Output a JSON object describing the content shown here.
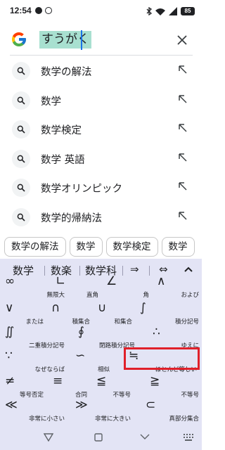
{
  "status_bar": {
    "time": "12:54",
    "battery": "85",
    "icons": [
      "chat-bubble-icon",
      "notification-icon",
      "bluetooth-icon",
      "wifi-icon",
      "signal-icon",
      "battery-icon"
    ]
  },
  "search": {
    "query": "すうがく",
    "logo": "google-g-logo",
    "clear_icon": "close-icon"
  },
  "suggestions": [
    {
      "text": "数学の解法"
    },
    {
      "text": "数学"
    },
    {
      "text": "数学検定"
    },
    {
      "text": "数学 英語"
    },
    {
      "text": "数学オリンピック"
    },
    {
      "text": "数学的帰納法"
    }
  ],
  "chips": [
    "数学の解法",
    "数学",
    "数学検定",
    "数学"
  ],
  "keyboard": {
    "candidates": [
      "数学",
      "数楽",
      "数学科"
    ],
    "candidate_arrows": [
      "⇒",
      "⇔"
    ],
    "collapse_icon": "chevron-up-icon",
    "symbols": [
      {
        "sym": "∞",
        "label": "無限大"
      },
      {
        "sym": "∟",
        "label": "直角"
      },
      {
        "sym": "∠",
        "label": "角"
      },
      {
        "sym": "∧",
        "label": "および"
      },
      {
        "sym": "∨",
        "label": "または"
      },
      {
        "sym": "∩",
        "label": "積集合"
      },
      {
        "sym": "∪",
        "label": "和集合"
      },
      {
        "sym": "∫",
        "label": "積分記号"
      },
      {
        "sym": "∬",
        "label": "二重積分記号"
      },
      {
        "sym": "∮",
        "label": "閉路積分記号"
      },
      {
        "sym": "∴",
        "label": "ゆえに"
      },
      {
        "sym": "∵",
        "label": "なぜならば"
      },
      {
        "sym": "∽",
        "label": "相似"
      },
      {
        "sym": "≒",
        "label": "ほとんど等しい"
      },
      {
        "sym": "≠",
        "label": "等号否定"
      },
      {
        "sym": "≡",
        "label": "合同"
      },
      {
        "sym": "≦",
        "label": "不等号"
      },
      {
        "sym": "≧",
        "label": "不等号"
      },
      {
        "sym": "≪",
        "label": "非常に小さい"
      },
      {
        "sym": "≫",
        "label": "非常に大きい"
      },
      {
        "sym": "⊂",
        "label": "真部分集合"
      }
    ]
  },
  "navbar": {
    "icons": [
      "back-icon",
      "home-icon",
      "recents-icon",
      "keyboard-switch-icon"
    ]
  }
}
